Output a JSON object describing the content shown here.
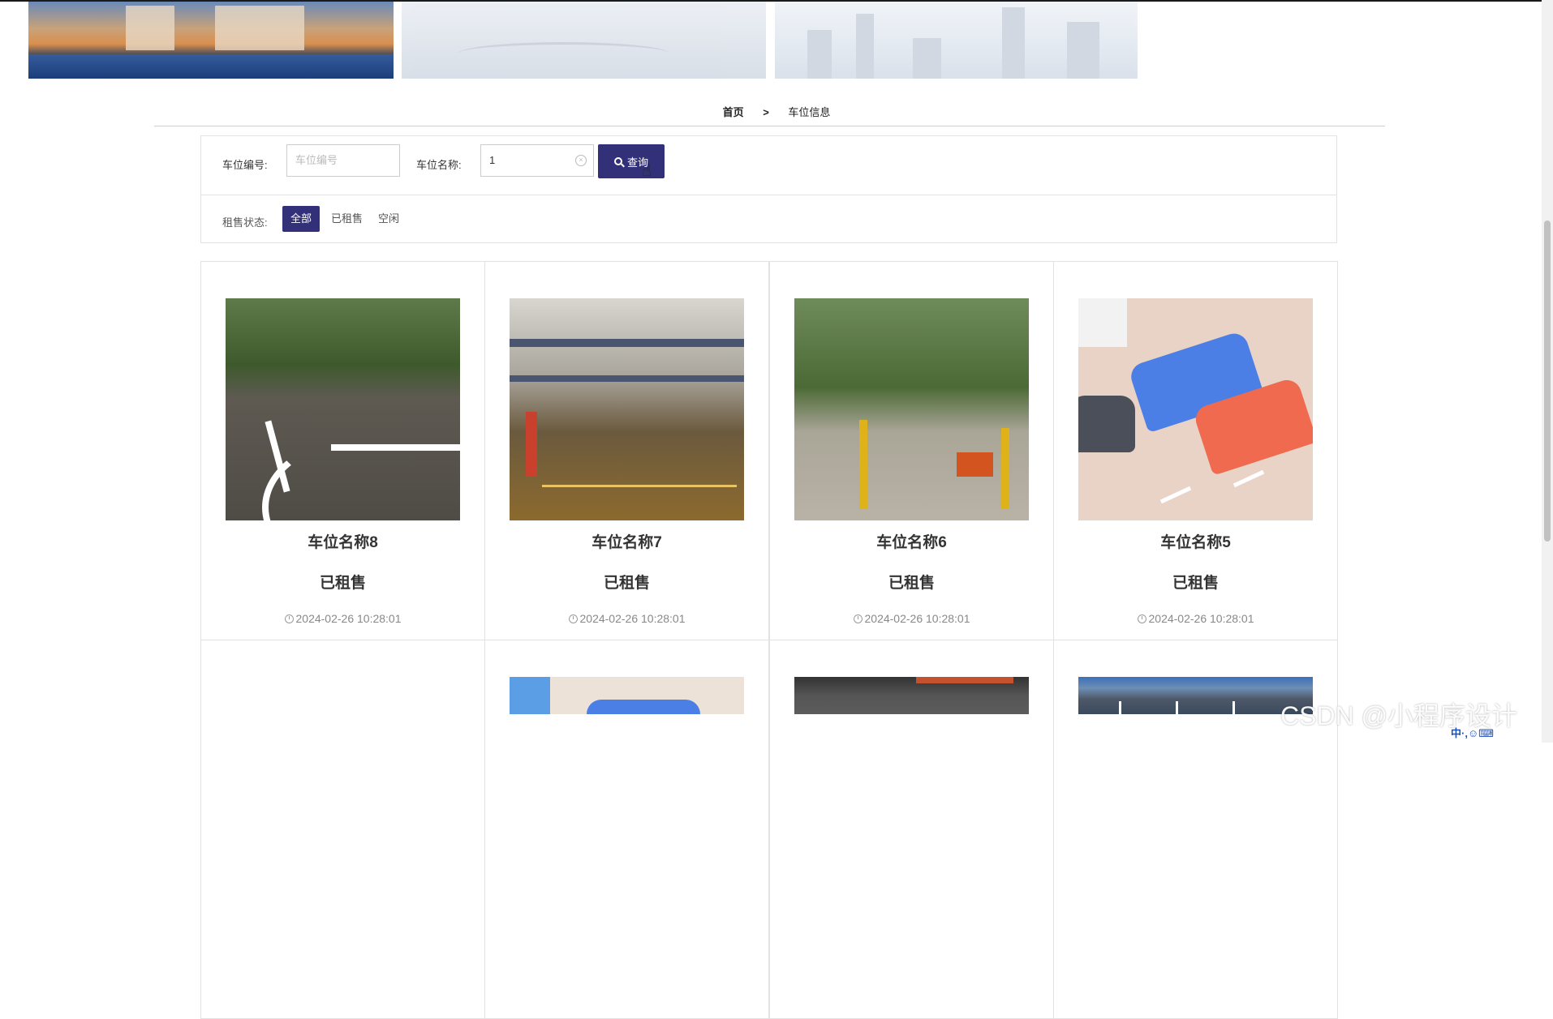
{
  "breadcrumb": {
    "home": "首页",
    "separator": ">",
    "current": "车位信息"
  },
  "filter": {
    "code_label": "车位编号:",
    "code_placeholder": "车位编号",
    "name_label": "车位名称:",
    "name_value": "1",
    "search_button": "查询",
    "status_label": "租售状态:",
    "status_options": [
      "全部",
      "已租售",
      "空闲"
    ],
    "status_selected": "全部"
  },
  "cards": [
    {
      "name": "车位名称8",
      "status": "已租售",
      "time": "2024-02-26 10:28:01"
    },
    {
      "name": "车位名称7",
      "status": "已租售",
      "time": "2024-02-26 10:28:01"
    },
    {
      "name": "车位名称6",
      "status": "已租售",
      "time": "2024-02-26 10:28:01"
    },
    {
      "name": "车位名称5",
      "status": "已租售",
      "time": "2024-02-26 10:28:01"
    }
  ],
  "watermark": "CSDN @小程序设计",
  "ime_indicator": "中·,☺⌨",
  "colors": {
    "accent": "#33307a",
    "border": "#e2e2e2",
    "text": "#333333"
  }
}
